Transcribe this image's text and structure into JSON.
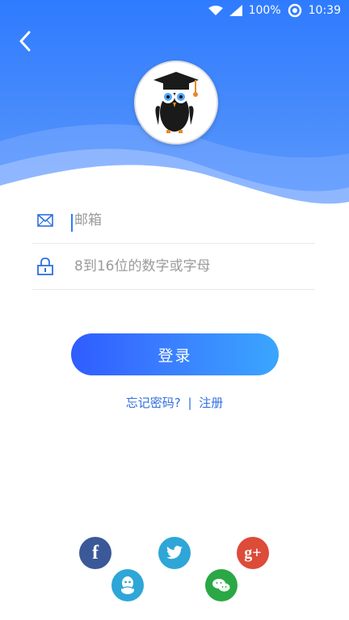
{
  "status_bar": {
    "battery_text": "100%",
    "time": "10:39"
  },
  "nav": {
    "back_icon": "chevron-left-icon"
  },
  "avatar": {
    "icon": "owl-graduate-logo"
  },
  "form": {
    "email_placeholder": "邮箱",
    "password_placeholder": "8到16位的数字或字母"
  },
  "actions": {
    "login_label": "登录",
    "forgot_password": "忘记密码?",
    "separator": "|",
    "register": "注册"
  },
  "social": [
    {
      "name": "facebook",
      "color": "#3b5998",
      "glyph": "f"
    },
    {
      "name": "twitter",
      "color": "#2ea6d7",
      "glyph": ""
    },
    {
      "name": "google-plus",
      "color": "#dd4b39",
      "glyph": "g+"
    },
    {
      "name": "qq",
      "color": "#2ea6d7",
      "glyph": ""
    },
    {
      "name": "wechat",
      "color": "#2aa845",
      "glyph": ""
    }
  ],
  "colors": {
    "primary": "#2f7bff",
    "link": "#2f6fe0"
  }
}
